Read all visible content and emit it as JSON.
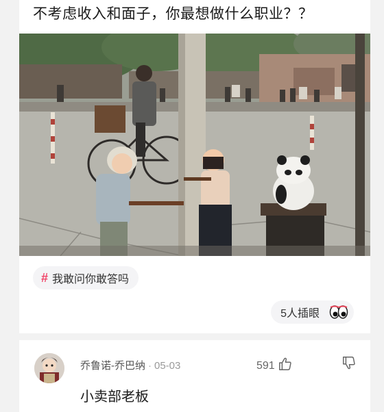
{
  "post": {
    "title": "不考虑收入和面子，你最想做什么职业？？",
    "photo_icon": "vintage-street-photo",
    "tag": {
      "icon": "hashtag-icon",
      "label": "我敢问你敢答吗"
    },
    "eye_counter": {
      "label": "5人插眼",
      "icon": "eyes-icon"
    }
  },
  "comment": {
    "username": "乔鲁诺-乔巴纳",
    "separator": "·",
    "date": "05-03",
    "like_count": "591",
    "text": "小卖部老板"
  },
  "colors": {
    "page_bg": "#f2f2f2",
    "card_bg": "#ffffff",
    "tag_accent": "#f0466a",
    "pill_bg": "#f4f4f6"
  }
}
